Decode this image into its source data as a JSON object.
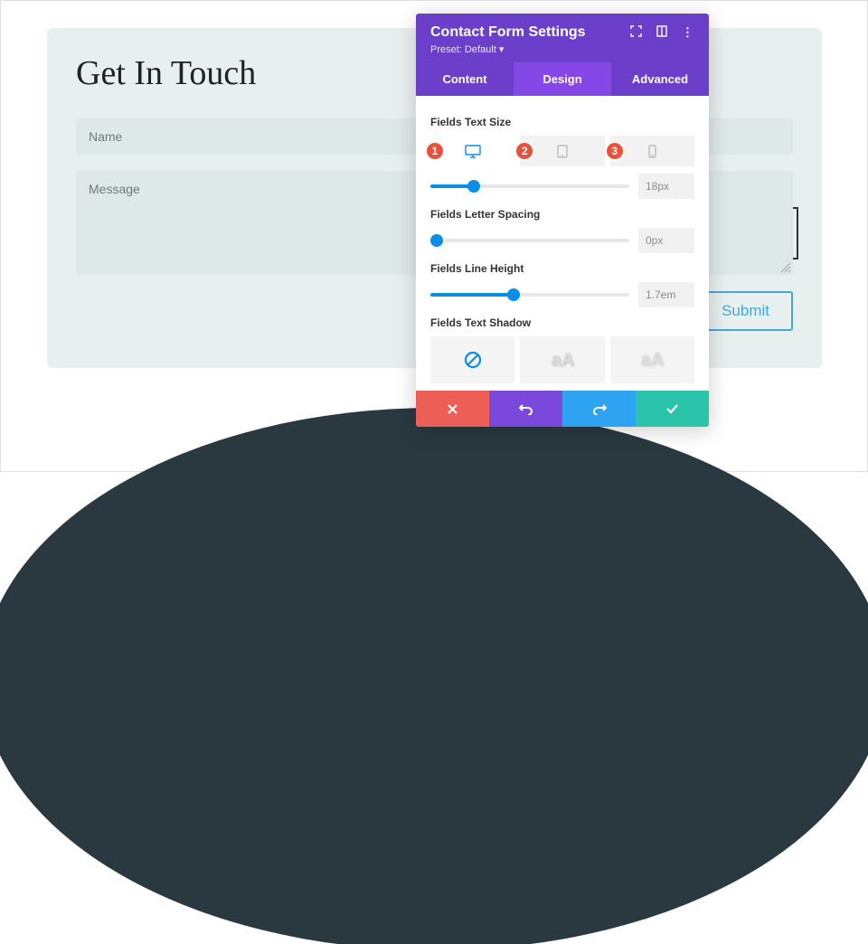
{
  "contact": {
    "title": "Get In Touch",
    "name_placeholder": "Name",
    "message_placeholder": "Message",
    "submit_label": "Submit"
  },
  "panel": {
    "title": "Contact Form Settings",
    "preset_label": "Preset: Default",
    "tabs": {
      "content": "Content",
      "design": "Design",
      "advanced": "Advanced"
    },
    "settings": {
      "text_size": {
        "label": "Fields Text Size",
        "value": "18px",
        "percent": 22
      },
      "letter_spacing": {
        "label": "Fields Letter Spacing",
        "value": "0px",
        "percent": 0
      },
      "line_height": {
        "label": "Fields Line Height",
        "value": "1.7em",
        "percent": 42
      },
      "text_shadow": {
        "label": "Fields Text Shadow",
        "opt1": "aA",
        "opt2": "aA"
      }
    },
    "badges": {
      "b1": "1",
      "b2": "2",
      "b3": "3"
    }
  }
}
